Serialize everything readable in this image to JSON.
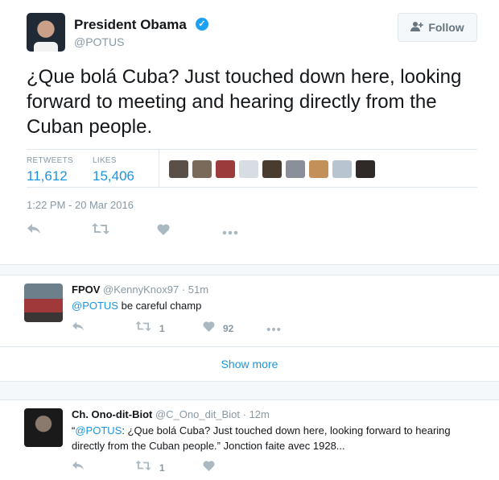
{
  "tweet": {
    "author_name": "President Obama",
    "author_handle": "@POTUS",
    "follow_label": "Follow",
    "text": "¿Que bolá Cuba? Just touched down here, looking forward to meeting and hearing directly from the Cuban people.",
    "retweets_label": "RETWEETS",
    "retweets_count": "11,612",
    "likes_label": "LIKES",
    "likes_count": "15,406",
    "timestamp": "1:22 PM - 20 Mar 2016",
    "liker_avatar_colors": [
      "#5b5048",
      "#7a6a5a",
      "#9c3b3b",
      "#d7dde2",
      "#4a3b2f",
      "#8a8f99",
      "#c29058",
      "#b8c4cf",
      "#2f2a28"
    ]
  },
  "replies": [
    {
      "name": "FPOV",
      "handle": "@KennyKnox97",
      "time": "51m",
      "mention": "@POTUS",
      "text": " be careful champ",
      "retweet_count": "1",
      "like_count": "92"
    },
    {
      "name": "Ch. Ono-dit-Biot",
      "handle": "@C_Ono_dit_Biot",
      "time": "12m",
      "quote_open": "“",
      "mention": "@POTUS",
      "text": ": ¿Que bolá Cuba? Just touched down here, looking forward to hearing directly from the Cuban people.” Jonction faite avec 1928...",
      "retweet_count": "1"
    }
  ],
  "show_more_label": "Show more",
  "icons": {
    "reply": "reply-icon",
    "retweet": "retweet-icon",
    "like": "heart-icon",
    "more": "more-icon",
    "verified": "verified-badge-icon",
    "follow": "add-user-icon"
  },
  "colors": {
    "link": "#1b95e0",
    "muted": "#8899a6",
    "icon": "#aab8c2",
    "verified": "#1da1f2"
  }
}
